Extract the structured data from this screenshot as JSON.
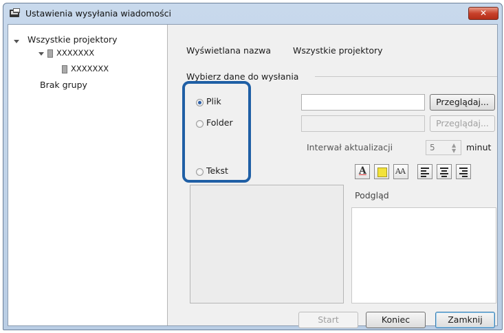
{
  "window": {
    "title": "Ustawienia wysyłania wiadomości",
    "close_label": "✕",
    "accent_color": "#1f5fa5"
  },
  "tree": {
    "root": "Wszystkie projektory",
    "child": "XXXXXXX",
    "grandchild": "XXXXXXX",
    "no_group": "Brak grupy"
  },
  "display_name": {
    "label": "Wyświetlana nazwa",
    "value": "Wszystkie projektory"
  },
  "section": {
    "title": "Wybierz dane do wysłania"
  },
  "options": {
    "file_label": "Plik",
    "folder_label": "Folder",
    "text_label": "Tekst",
    "selected": "Plik"
  },
  "browse": {
    "file_button": "Przeglądaj...",
    "folder_button": "Przeglądaj..."
  },
  "interval": {
    "label": "Interwał aktualizacji",
    "value": "5",
    "unit": "minut"
  },
  "format_toolbar": {
    "font_color_icon": "font-color-icon",
    "highlight_icon": "background-color-icon",
    "font_size_icon": "font-size-icon",
    "align_left_icon": "align-left-icon",
    "align_center_icon": "align-center-icon",
    "align_right_icon": "align-right-icon",
    "font_color_glyph": "A",
    "font_size_glyph": "AA"
  },
  "preview": {
    "label": "Podgląd"
  },
  "footer": {
    "start_label": "Start",
    "end_label": "Koniec",
    "close_label": "Zamknij"
  }
}
